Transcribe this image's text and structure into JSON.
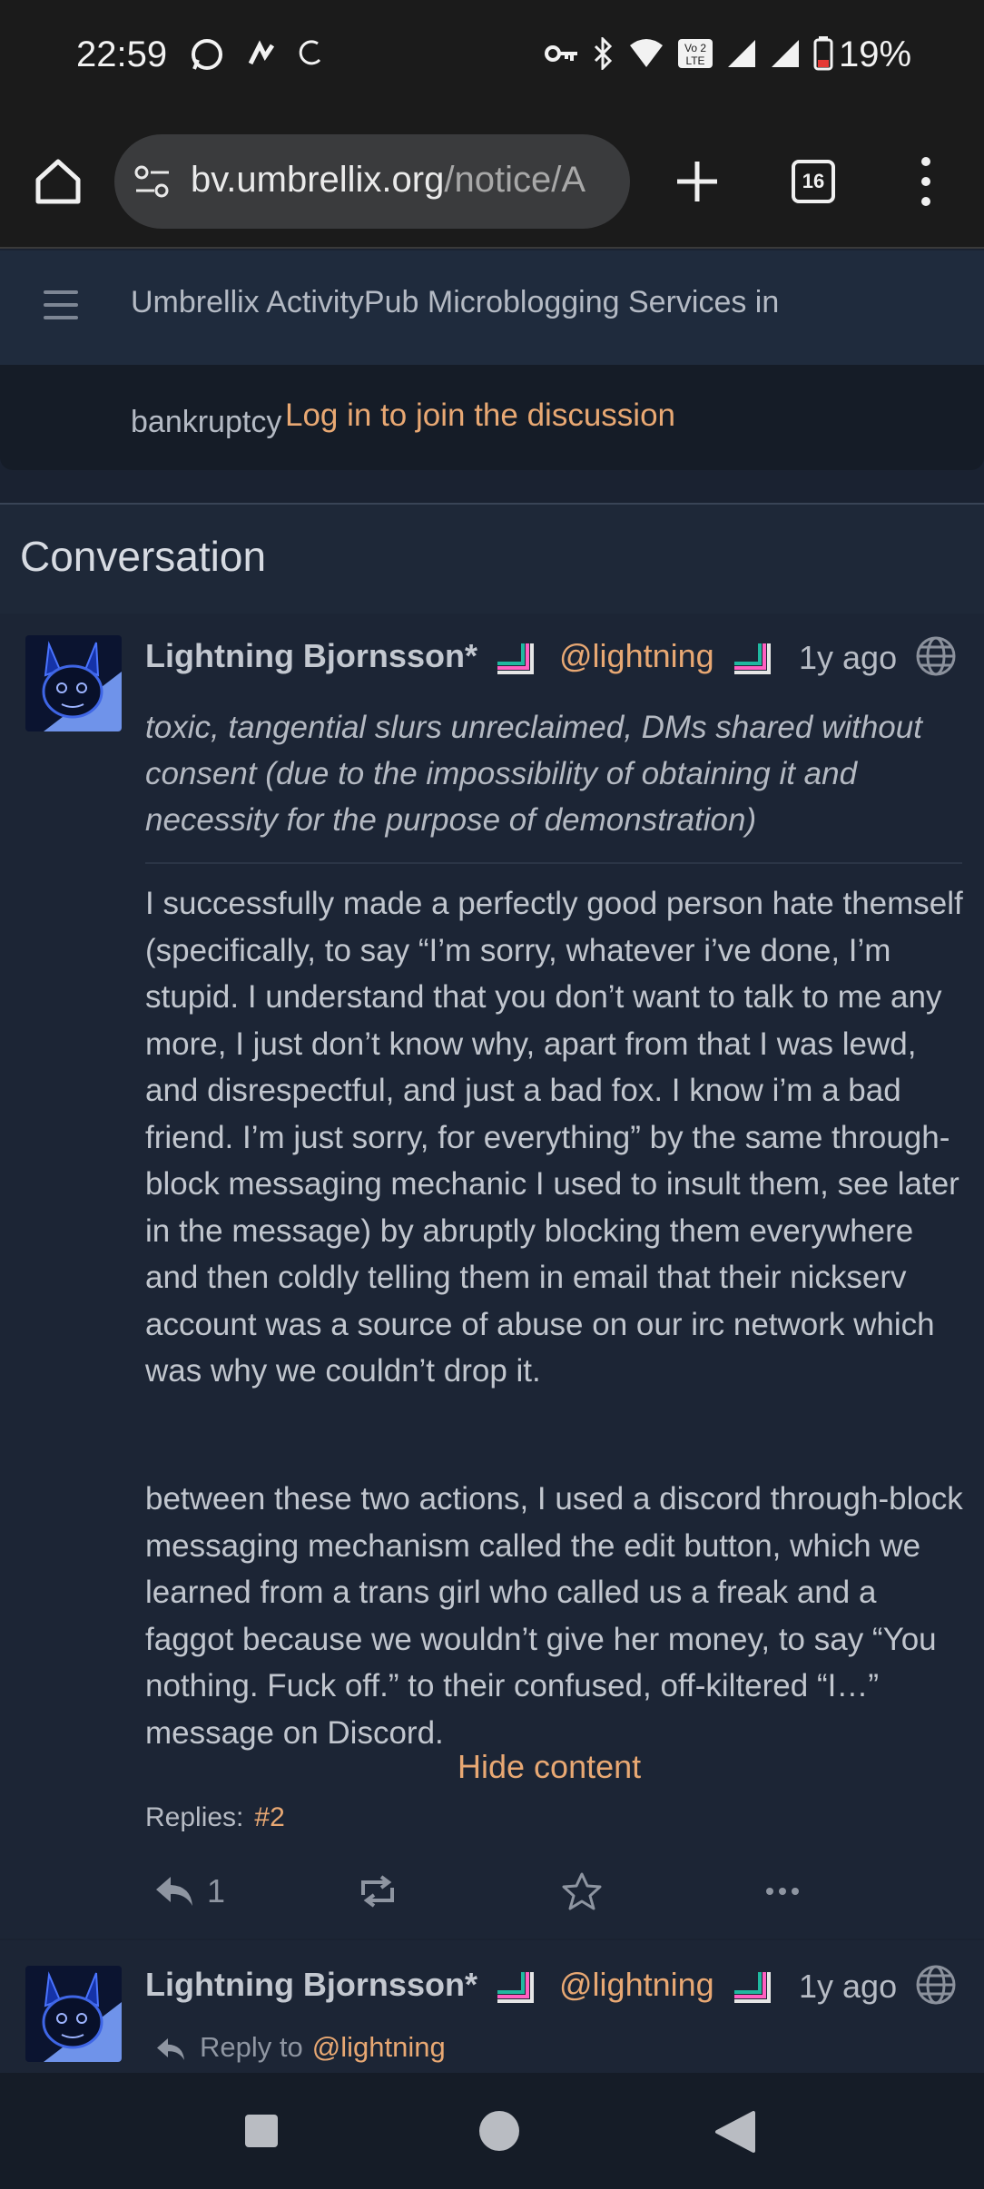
{
  "status_bar": {
    "time": "22:59",
    "battery": "19%",
    "icons": [
      "whatsapp-icon",
      "app-icon",
      "sync-icon",
      "key-icon",
      "bluetooth-icon",
      "wifi-icon",
      "volte-icon",
      "signal-icon",
      "signal-icon",
      "battery-icon"
    ]
  },
  "browser": {
    "url_host": "bv.umbrellix.org",
    "url_path": "/notice/A",
    "tab_count": "16"
  },
  "site": {
    "title_line1": "Umbrellix ActivityPub Microblogging Services in",
    "title_line2": "bankruptcy",
    "login_link": "Log in to join the discussion"
  },
  "conversation": {
    "title": "Conversation"
  },
  "post1": {
    "author": "Lightning Bjornsson*",
    "handle": "@lightning",
    "time_ago": "1y ago",
    "content_warning": "toxic, tangential slurs unreclaimed, DMs shared without consent (due to the impossibility of obtaining it and necessity for the purpose of demonstration)",
    "paragraph1": "I successfully made a perfectly good person hate themself (specifically, to say “I’m sorry, whatever i’ve done, I’m stupid.   I understand that you don’t want to talk to me any more, I just don’t know why, apart from that I was lewd, and disrespectful, and just a bad fox.  I know i’m a bad friend.  I’m just sorry, for everything” by the same through-block messaging mechanic I used to insult them, see later in the message) by abruptly blocking them everywhere and then coldly telling them in email that their nickserv account was a source of abuse on our irc network which was why we couldn’t drop it.",
    "paragraph2": "between these two actions, I used a discord through-block messaging mechanism called the edit button, which we learned from a trans girl who called us a freak and a faggot because we wouldn’t give her money, to say “You nothing. Fuck off.” to their confused, off-kiltered “I…” message on Discord.",
    "hide_content": "Hide content",
    "replies_label": "Replies:",
    "replies_link": "#2",
    "reply_count": "1"
  },
  "post2": {
    "author": "Lightning Bjornsson*",
    "handle": "@lightning",
    "time_ago": "1y ago",
    "reply_to_label": "Reply to",
    "reply_to_handle": "@lightning"
  },
  "colors": {
    "accent": "#e8a873",
    "background": "#1a2231",
    "header": "#1f2b3d"
  }
}
